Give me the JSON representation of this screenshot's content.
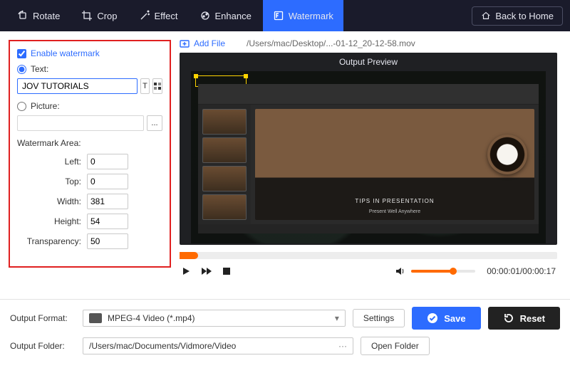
{
  "toolbar": {
    "rotate": "Rotate",
    "crop": "Crop",
    "effect": "Effect",
    "enhance": "Enhance",
    "watermark": "Watermark",
    "back_home": "Back to Home",
    "active": "watermark"
  },
  "watermark_panel": {
    "enable_label": "Enable watermark",
    "enable_checked": true,
    "text_label": "Text:",
    "text_selected": true,
    "text_value": "JOV TUTORIALS",
    "text_font_btn": "T",
    "picture_label": "Picture:",
    "picture_selected": false,
    "picture_value": "",
    "browse_btn": "...",
    "area_label": "Watermark Area:",
    "fields": {
      "left": {
        "label": "Left:",
        "value": "0"
      },
      "top": {
        "label": "Top:",
        "value": "0"
      },
      "width": {
        "label": "Width:",
        "value": "381"
      },
      "height": {
        "label": "Height:",
        "value": "54"
      },
      "transparency": {
        "label": "Transparency:",
        "value": "50"
      }
    }
  },
  "preview": {
    "add_file_label": "Add File",
    "file_path": "/Users/mac/Desktop/...-01-12_20-12-58.mov",
    "title": "Output Preview",
    "slide_caption": "TIPS IN PRESENTATION",
    "slide_sub": "Present Well Anywhere",
    "time_current": "00:00:01",
    "time_total": "00:00:17"
  },
  "output": {
    "format_label": "Output Format:",
    "format_value": "MPEG-4 Video (*.mp4)",
    "settings_btn": "Settings",
    "folder_label": "Output Folder:",
    "folder_value": "/Users/mac/Documents/Vidmore/Video",
    "open_folder_btn": "Open Folder",
    "save_btn": "Save",
    "reset_btn": "Reset"
  }
}
